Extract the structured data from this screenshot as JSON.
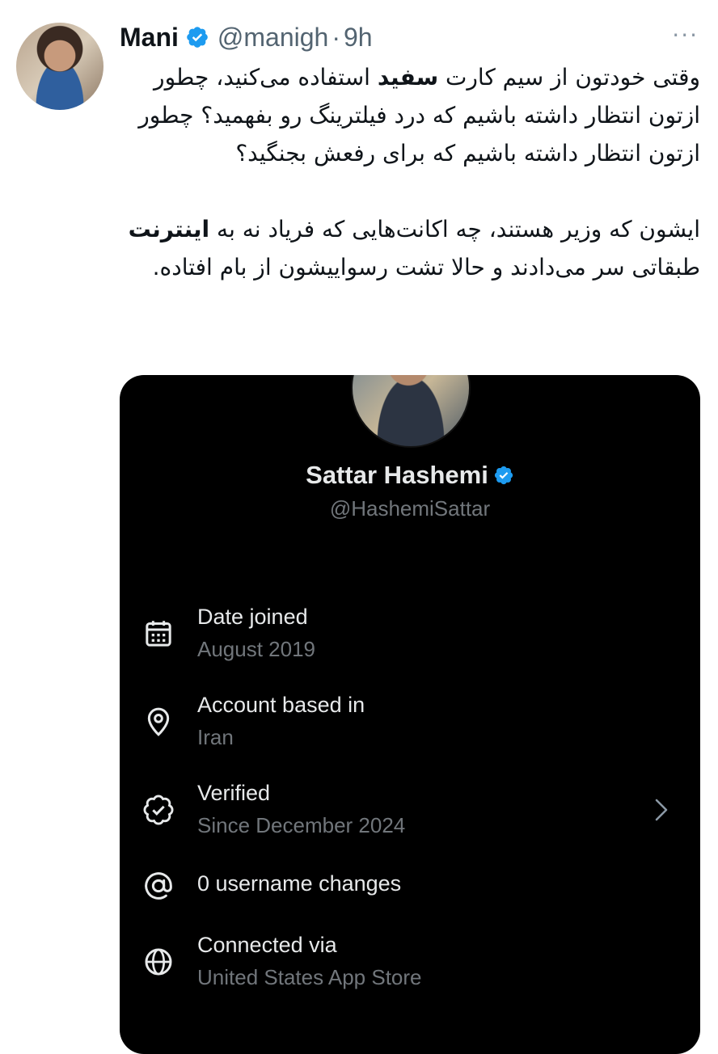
{
  "tweet": {
    "author_name": "Mani",
    "handle": "@manigh",
    "separator": "·",
    "time": "9h",
    "more_label": "···",
    "paragraph1": {
      "part1": "وقتی خودتون از سیم کارت ",
      "bold1": "سفید",
      "part2": " استفاده می‌کنید، چطور ازتون انتظار داشته باشیم که درد فیلترینگ رو بفهمید؟ چطور ازتون انتظار داشته باشیم که برای رفعش بجنگید؟"
    },
    "paragraph2": {
      "part1": "ایشون که وزیر هستند، چه اکانت‌هایی که فریاد نه به ",
      "bold1": "اینترنت",
      "part2": " طبقاتی سر می‌دادند و حالا تشت رسواییشون از بام افتاده."
    }
  },
  "card": {
    "profile_name": "Sattar Hashemi",
    "profile_handle": "@HashemiSattar",
    "rows": [
      {
        "title": "Date joined",
        "sub": "August 2019",
        "icon": "calendar-icon"
      },
      {
        "title": "Account based in",
        "sub": "Iran",
        "icon": "location-pin-icon"
      },
      {
        "title": "Verified",
        "sub": "Since December 2024",
        "icon": "verified-badge-icon"
      },
      {
        "title": "0 username changes",
        "sub": "",
        "icon": "at-sign-icon"
      },
      {
        "title": "Connected via",
        "sub": "United States App Store",
        "icon": "globe-icon"
      }
    ]
  },
  "colors": {
    "verified_blue": "#1d9bf0",
    "card_bg": "#000000",
    "card_text": "#e7e9ea",
    "card_muted": "#71767b",
    "handle_gray": "#536471"
  }
}
